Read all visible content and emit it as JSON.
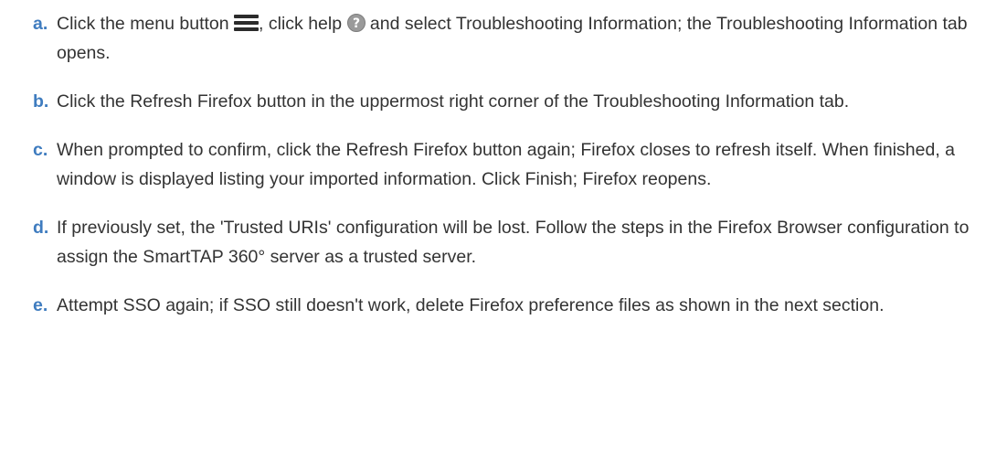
{
  "steps": [
    {
      "marker": "a.",
      "text_part1": "Click the menu button",
      "menu_icon": "hamburger-menu-icon",
      "text_part2": ", click help",
      "help_icon": "question-mark-icon",
      "text_part3": "and select Troubleshooting Information; the Troubleshooting Information tab opens."
    },
    {
      "marker": "b.",
      "text": "Click the Refresh Firefox button in the uppermost right corner of the Troubleshooting Information tab."
    },
    {
      "marker": "c.",
      "text": "When prompted to confirm, click the Refresh Firefox button again; Firefox closes to refresh itself. When finished, a window is displayed listing your imported information. Click Finish; Firefox reopens."
    },
    {
      "marker": "d.",
      "text": "If previously set, the 'Trusted URIs' configuration will be lost. Follow the steps in the Firefox Browser configuration to assign the SmartTAP 360° server as a trusted server."
    },
    {
      "marker": "e.",
      "text": "Attempt SSO again; if SSO still doesn't work, delete Firefox preference files as shown in the next section."
    }
  ],
  "colors": {
    "marker": "#3f7cbf",
    "body_text": "#333333",
    "menu_icon": "#2b2b2b",
    "help_icon_bg": "#9a9a9a"
  }
}
